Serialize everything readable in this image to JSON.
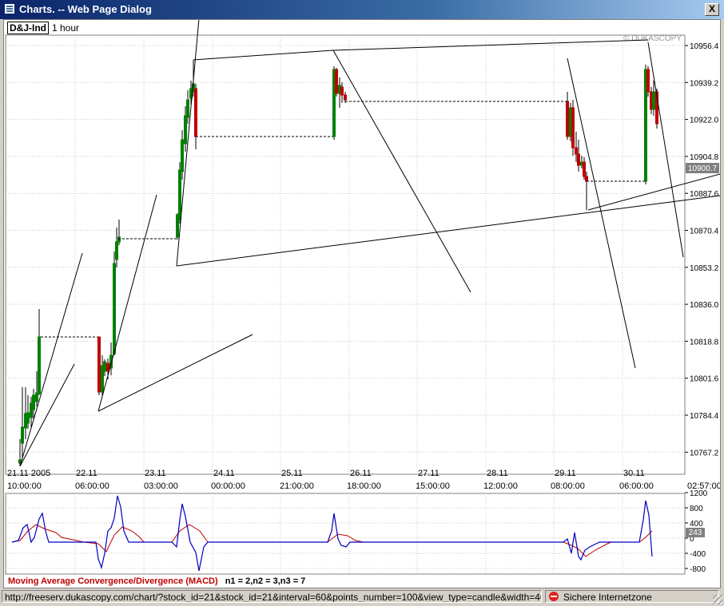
{
  "window": {
    "title": "Charts. -- Web Page Dialog",
    "close_label": "X"
  },
  "chart_header": {
    "symbol": "D&J-Ind",
    "interval": "1 hour",
    "watermark": "© DUKASCOPY"
  },
  "price_axis": {
    "ticks": [
      "10956.4",
      "10939.2",
      "10922.0",
      "10904.8",
      "10887.6",
      "10870.4",
      "10853.2",
      "10836.0",
      "10818.8",
      "10801.6",
      "10784.4",
      "10767.2"
    ],
    "current": "10900.7"
  },
  "date_axis": {
    "dates": [
      "21.11 2005",
      "22.11",
      "23.11",
      "24.11",
      "25.11",
      "26.11",
      "27.11",
      "28.11",
      "29.11",
      "30.11"
    ],
    "times": [
      "10:00:00",
      "06:00:00",
      "03:00:00",
      "00:00:00",
      "21:00:00",
      "18:00:00",
      "15:00:00",
      "12:00:00",
      "08:00:00",
      "06:00:00",
      "02:57:00"
    ]
  },
  "macd": {
    "ticks": [
      "1200",
      "800",
      "400",
      "0",
      "-400",
      "-800"
    ],
    "current": "243",
    "title": "Moving Average Convergence/Divergence (MACD)",
    "params": "n1 = 2,n2 = 3,n3 = 7"
  },
  "chart_data": {
    "type": "candlestick",
    "ylim": [
      10760,
      10964
    ],
    "up_color": "#008000",
    "down_color": "#c00000",
    "macd_line_color": "#0000c0",
    "signal_line_color": "#c00000",
    "macd_ylim": [
      -800,
      1200
    ]
  },
  "status": {
    "url": "http://freeserv.dukascopy.com/chart/?stock_id=21&stock_id=21&interval=60&points_number=100&view_type=candle&width=400&height=30",
    "zone": "Sichere Internetzone"
  }
}
